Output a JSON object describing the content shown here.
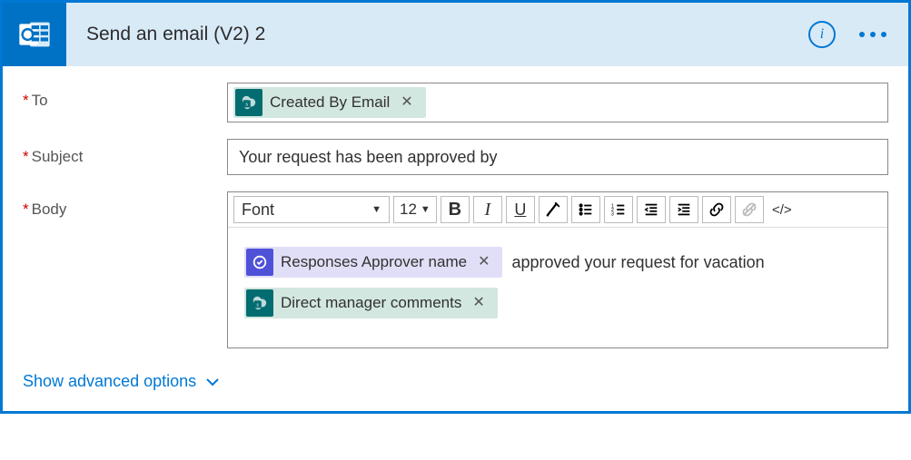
{
  "header": {
    "title": "Send an email (V2) 2"
  },
  "fields": {
    "to": {
      "label": "To",
      "token": {
        "icon_letter": "s",
        "label": "Created By Email"
      }
    },
    "subject": {
      "label": "Subject",
      "value": "Your request has been approved by"
    },
    "body": {
      "label": "Body",
      "toolbar": {
        "font": "Font",
        "size": "12",
        "bold": "B",
        "italic": "I",
        "underline": "U",
        "code": "</>"
      },
      "content": {
        "token1": {
          "label": "Responses Approver name"
        },
        "text1": "approved your request for vacation",
        "token2": {
          "icon_letter": "s",
          "label": "Direct manager comments"
        }
      }
    }
  },
  "advanced_link": "Show advanced options"
}
